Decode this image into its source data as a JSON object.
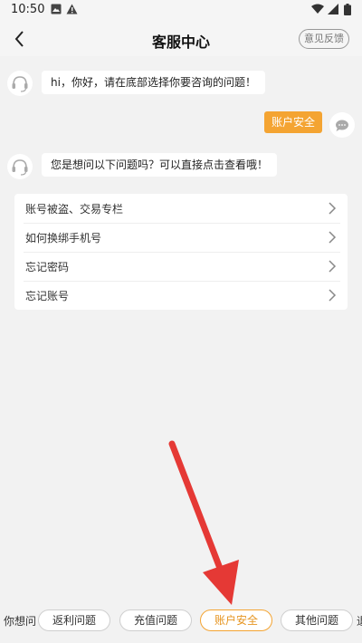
{
  "status_bar": {
    "time": "10:50",
    "left_icons": [
      "photo-icon",
      "warning-icon"
    ],
    "right_icons": [
      "wifi-icon",
      "signal-icon",
      "battery-icon"
    ]
  },
  "header": {
    "title": "客服中心",
    "feedback_label": "意见反馈"
  },
  "chat": {
    "bot_greeting": "hi，你好，请在底部选择你要咨询的问题！",
    "user_message": "账户安全",
    "bot_prompt": "您是想问以下问题吗？可以直接点击查看哦！",
    "questions": [
      "账号被盗、交易专栏",
      "如何换绑手机号",
      "忘记密码",
      "忘记账号"
    ]
  },
  "bottom_bar": {
    "prompt_label": "你想问",
    "chips": [
      {
        "label": "返利问题",
        "active": false
      },
      {
        "label": "充值问题",
        "active": false
      },
      {
        "label": "账户安全",
        "active": true
      },
      {
        "label": "其他问题",
        "active": false
      }
    ],
    "overflow_char": "退"
  },
  "colors": {
    "accent": "#f4a432",
    "annotation_arrow": "#e53935",
    "background": "#f2f2f2"
  }
}
